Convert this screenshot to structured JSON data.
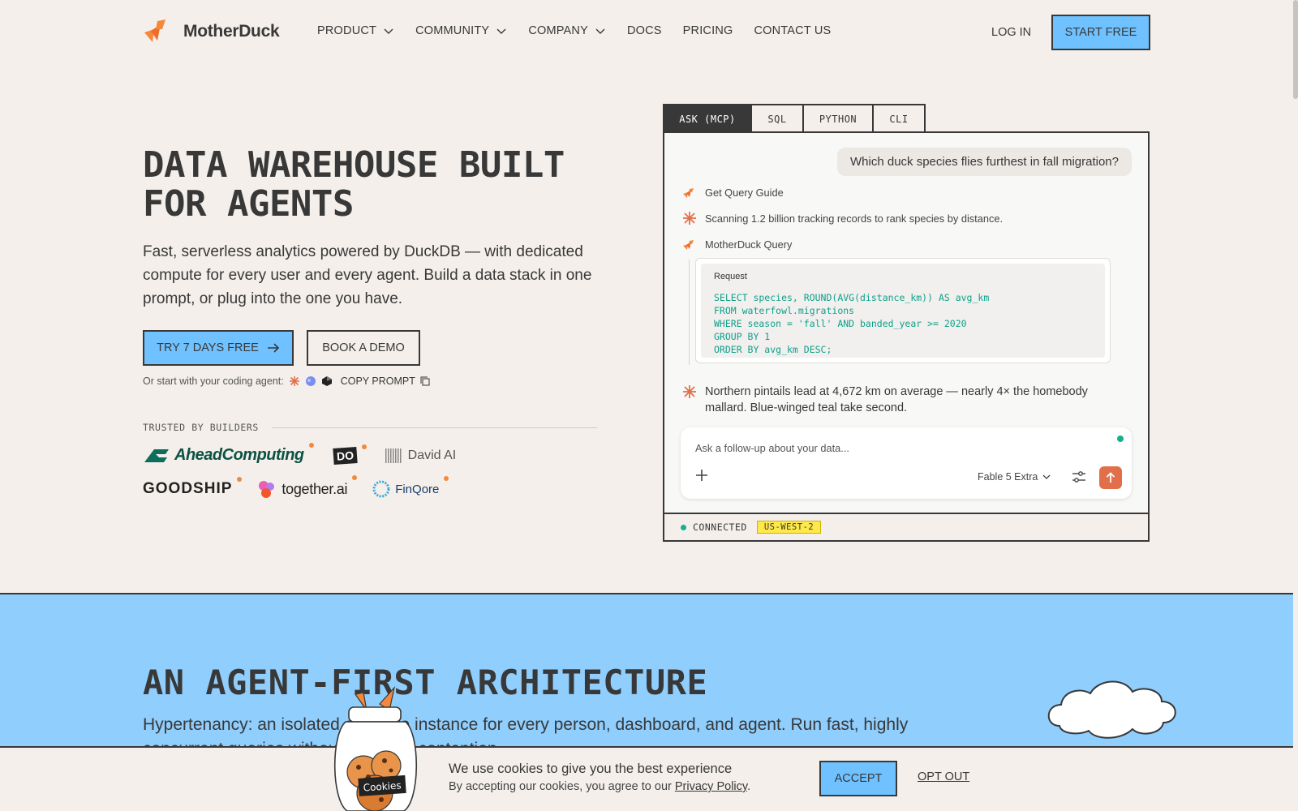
{
  "nav": {
    "logo_text": "MotherDuck",
    "items": [
      {
        "label": "PRODUCT",
        "dropdown": true
      },
      {
        "label": "COMMUNITY",
        "dropdown": true
      },
      {
        "label": "COMPANY",
        "dropdown": true
      },
      {
        "label": "DOCS",
        "dropdown": false
      },
      {
        "label": "PRICING",
        "dropdown": false
      },
      {
        "label": "CONTACT US",
        "dropdown": false
      }
    ],
    "login": "LOG IN",
    "start_free": "START FREE"
  },
  "hero": {
    "title": "DATA WAREHOUSE BUILT FOR AGENTS",
    "subtitle": "Fast, serverless analytics powered by DuckDB — with dedicated compute for every user and every agent. Build a data stack in one prompt, or plug into the one you have.",
    "try_button": "TRY 7 DAYS FREE",
    "demo_button": "BOOK A DEMO",
    "agent_text": "Or start with your coding agent:",
    "copy_prompt": "COPY PROMPT",
    "trusted_label": "TRUSTED BY BUILDERS",
    "logos": [
      "AheadComputing",
      "DO",
      "David AI",
      "GOODSHIP",
      "together.ai",
      "FinQore"
    ]
  },
  "chat": {
    "tabs": [
      "ASK (MCP)",
      "SQL",
      "PYTHON",
      "CLI"
    ],
    "user_message": "Which duck species flies furthest in fall migration?",
    "step1": "Get Query Guide",
    "step2": "Scanning 1.2 billion tracking records to rank species by distance.",
    "step3": "MotherDuck Query",
    "request_label": "Request",
    "query": "SELECT species, ROUND(AVG(distance_km)) AS avg_km\nFROM waterfowl.migrations\nWHERE season = 'fall' AND banded_year >= 2020\nGROUP BY 1\nORDER BY avg_km DESC;",
    "answer": "Northern pintails lead at 4,672 km on average — nearly 4× the homebody mallard. Blue-winged teal take second.",
    "input_placeholder": "Ask a follow-up about your data...",
    "model": "Fable 5 Extra",
    "status": "CONNECTED",
    "region": "US-WEST-2"
  },
  "architecture": {
    "title": "AN AGENT-FIRST ARCHITECTURE",
    "subtitle": "Hypertenancy: an isolated compute instance for every person, dashboard, and agent. Run fast, highly concurrent queries without resource contention."
  },
  "cookie": {
    "jar_label": "Cookies",
    "title": "We use cookies to give you the best experience",
    "text": "By accepting our cookies, you agree to our",
    "link": "Privacy Policy",
    "accept": "ACCEPT",
    "opt_out": "OPT OUT"
  },
  "colors": {
    "background": "#f4efea",
    "accent_blue": "#6fc2ff",
    "section_blue": "#8fcefd",
    "text": "#383838",
    "sql_green": "#10a08a",
    "orange": "#e1704a",
    "region_yellow": "#ffe94a"
  }
}
